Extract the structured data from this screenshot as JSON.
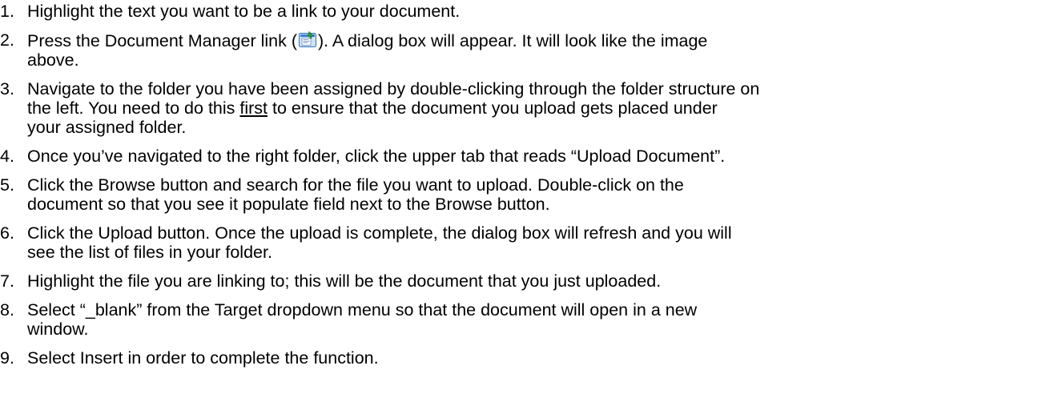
{
  "instructions": {
    "steps": [
      {
        "number": "1.",
        "lines": [
          "Highlight the text you want to be a link to your document."
        ]
      },
      {
        "number": "2.",
        "before_icon": "Press the Document Manager link (",
        "after_icon": ").  A dialog box will appear.  It will look like the image",
        "line2": "above.",
        "icon": "document-manager-icon"
      },
      {
        "number": "3.",
        "line1": "Navigate to the folder you have been assigned by double-clicking through the folder structure on",
        "line2_before": "the left.  You need to do this ",
        "line2_underlined": "first",
        "line2_after": " to ensure that the document you upload gets placed under",
        "line3": "your assigned folder."
      },
      {
        "number": "4.",
        "lines": [
          "Once you’ve navigated to the right folder, click the upper tab that reads “Upload Document”."
        ]
      },
      {
        "number": "5.",
        "lines": [
          "Click the Browse button and search for the file you want to upload.  Double-click on the",
          "document so that you see it populate field next to the Browse button."
        ]
      },
      {
        "number": "6.",
        "lines": [
          "Click the Upload button.  Once the upload is complete, the dialog box will refresh and you will",
          "see the list of files in your folder."
        ]
      },
      {
        "number": "7.",
        "lines": [
          "Highlight the file you are linking to; this will be the document that you just uploaded."
        ]
      },
      {
        "number": "8.",
        "lines": [
          "Select “_blank” from the Target dropdown menu so that the document will open in a new",
          "window."
        ]
      },
      {
        "number": "9.",
        "lines": [
          "Select Insert in order to complete the function."
        ]
      }
    ]
  }
}
